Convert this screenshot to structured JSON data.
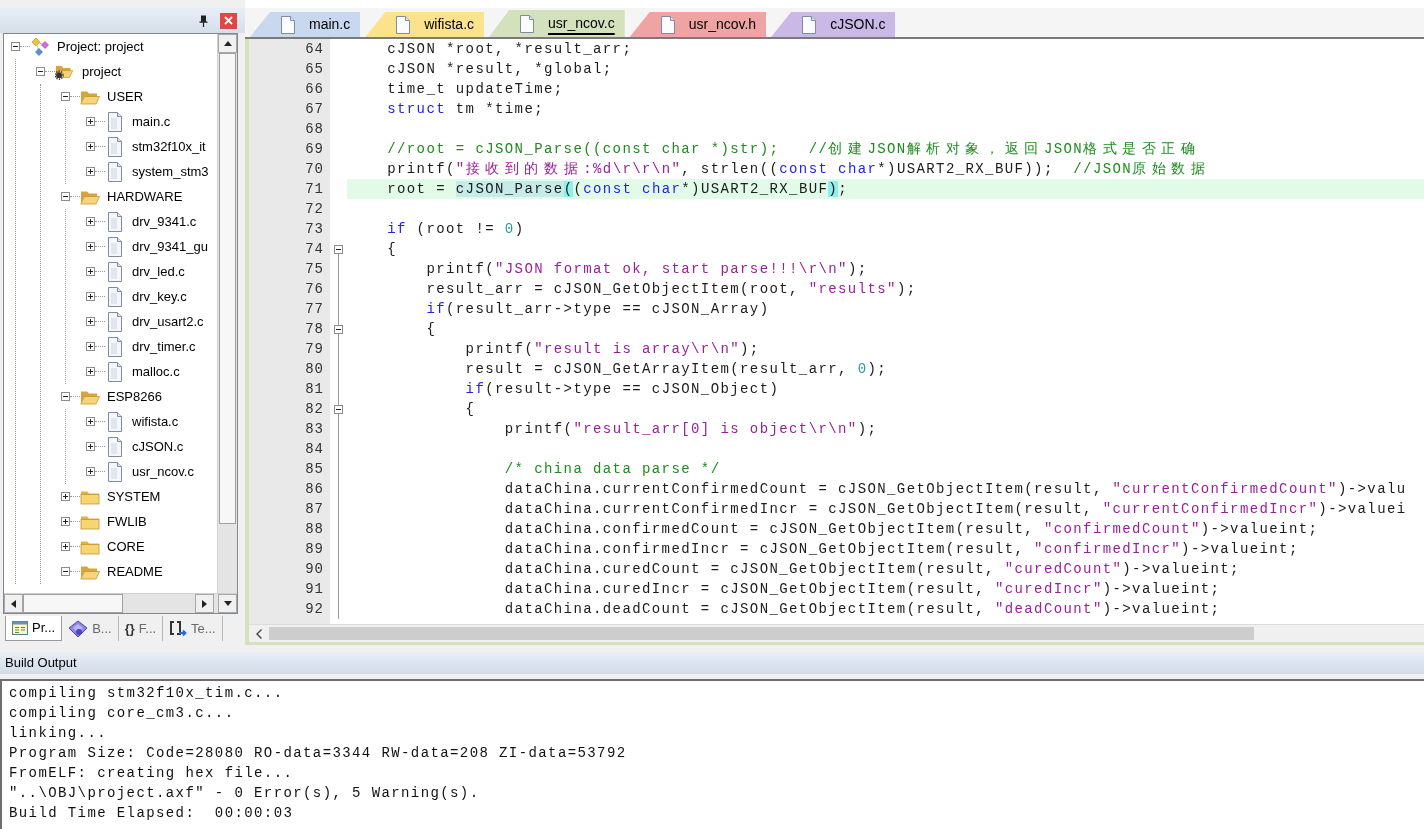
{
  "explorer": {
    "tree": [
      {
        "label": "Project: project",
        "kind": "project",
        "expanded": true,
        "children": [
          {
            "label": "project",
            "kind": "target",
            "expanded": true,
            "children": [
              {
                "label": "USER",
                "kind": "group",
                "expanded": true,
                "children": [
                  {
                    "label": "main.c",
                    "kind": "file",
                    "expanded": false
                  },
                  {
                    "label": "stm32f10x_it",
                    "kind": "file",
                    "expanded": false
                  },
                  {
                    "label": "system_stm3",
                    "kind": "file",
                    "expanded": false
                  }
                ]
              },
              {
                "label": "HARDWARE",
                "kind": "group",
                "expanded": true,
                "children": [
                  {
                    "label": "drv_9341.c",
                    "kind": "file",
                    "expanded": false
                  },
                  {
                    "label": "drv_9341_gu",
                    "kind": "file",
                    "expanded": false
                  },
                  {
                    "label": "drv_led.c",
                    "kind": "file",
                    "expanded": false
                  },
                  {
                    "label": "drv_key.c",
                    "kind": "file",
                    "expanded": false
                  },
                  {
                    "label": "drv_usart2.c",
                    "kind": "file",
                    "expanded": false
                  },
                  {
                    "label": "drv_timer.c",
                    "kind": "file",
                    "expanded": false
                  },
                  {
                    "label": "malloc.c",
                    "kind": "file",
                    "expanded": false
                  }
                ]
              },
              {
                "label": "ESP8266",
                "kind": "group",
                "expanded": true,
                "children": [
                  {
                    "label": "wifista.c",
                    "kind": "file",
                    "expanded": false
                  },
                  {
                    "label": "cJSON.c",
                    "kind": "file",
                    "expanded": false
                  },
                  {
                    "label": "usr_ncov.c",
                    "kind": "file",
                    "expanded": false
                  }
                ]
              },
              {
                "label": "SYSTEM",
                "kind": "group",
                "expanded": false
              },
              {
                "label": "FWLIB",
                "kind": "group",
                "expanded": false
              },
              {
                "label": "CORE",
                "kind": "group",
                "expanded": false
              },
              {
                "label": "README",
                "kind": "group",
                "expanded": true
              }
            ]
          }
        ]
      }
    ],
    "tabs": [
      {
        "label": "Pr...",
        "kind": "project",
        "selected": true
      },
      {
        "label": "B...",
        "kind": "books",
        "selected": false
      },
      {
        "label": "F...",
        "kind": "functions",
        "glyph": "{}",
        "selected": false
      },
      {
        "label": "Te...",
        "kind": "templates",
        "selected": false
      }
    ]
  },
  "editor": {
    "tabs": [
      {
        "label": "main.c",
        "color": "#c7d8ef",
        "selected": false
      },
      {
        "label": "wifista.c",
        "color": "#fbe38d",
        "selected": false
      },
      {
        "label": "usr_ncov.c",
        "color": "#d3e1bc",
        "selected": true
      },
      {
        "label": "usr_ncov.h",
        "color": "#f0a3a3",
        "selected": false
      },
      {
        "label": "cJSON.c",
        "color": "#cab9e6",
        "selected": false
      }
    ],
    "lines": [
      {
        "number": "64",
        "fold": false,
        "current": false,
        "segments": [
          {
            "kind": "plain",
            "text": "    cJSON *root, *result_arr;"
          }
        ]
      },
      {
        "number": "65",
        "fold": false,
        "current": false,
        "segments": [
          {
            "kind": "plain",
            "text": "    cJSON *result, *global;"
          }
        ]
      },
      {
        "number": "66",
        "fold": false,
        "current": false,
        "segments": [
          {
            "kind": "plain",
            "text": "    time_t updateTime;"
          }
        ]
      },
      {
        "number": "67",
        "fold": false,
        "current": false,
        "segments": [
          {
            "kind": "keyword",
            "text": "    struct"
          },
          {
            "kind": "plain",
            "text": " tm *time;"
          }
        ]
      },
      {
        "number": "68",
        "fold": false,
        "current": false
      },
      {
        "number": "69",
        "fold": false,
        "current": false,
        "segments": [
          {
            "kind": "comment",
            "text": "    //root = cJSON_Parse((const char *)str);   //创建JSON解析对象，返回JSON格式是否正确"
          }
        ]
      },
      {
        "number": "70",
        "fold": false,
        "current": false,
        "segments": [
          {
            "kind": "plain",
            "text": "    printf("
          },
          {
            "kind": "string",
            "text": "\"接收到的数据:%d\\r\\r\\n\""
          },
          {
            "kind": "plain",
            "text": ", strlen(("
          },
          {
            "kind": "keyword",
            "text": "const char"
          },
          {
            "kind": "plain",
            "text": "*)USART2_RX_BUF));  "
          },
          {
            "kind": "comment",
            "text": "//JSON原始数据"
          }
        ]
      },
      {
        "number": "71",
        "fold": false,
        "current": true,
        "segments": [
          {
            "kind": "plain",
            "text": "    root = "
          },
          {
            "kind": "highlight",
            "text": "cJSON_Parse"
          },
          {
            "kind": "brace",
            "text": "("
          },
          {
            "kind": "plain",
            "text": "("
          },
          {
            "kind": "keyword",
            "text": "const char"
          },
          {
            "kind": "plain",
            "text": "*)USART2_RX_BUF"
          },
          {
            "kind": "brace",
            "text": ")"
          },
          {
            "kind": "plain",
            "text": ";"
          }
        ]
      },
      {
        "number": "72",
        "fold": false,
        "current": false
      },
      {
        "number": "73",
        "fold": false,
        "current": false,
        "segments": [
          {
            "kind": "keyword",
            "text": "    if"
          },
          {
            "kind": "plain",
            "text": " (root != "
          },
          {
            "kind": "number",
            "text": "0"
          },
          {
            "kind": "plain",
            "text": ")"
          }
        ]
      },
      {
        "number": "74",
        "fold": true,
        "current": false,
        "segments": [
          {
            "kind": "plain",
            "text": "    {"
          }
        ]
      },
      {
        "number": "75",
        "fold": false,
        "current": false,
        "segments": [
          {
            "kind": "plain",
            "text": "        printf("
          },
          {
            "kind": "string",
            "text": "\"JSON format ok, start parse!!!\\r\\n\""
          },
          {
            "kind": "plain",
            "text": ");"
          }
        ]
      },
      {
        "number": "76",
        "fold": false,
        "current": false,
        "segments": [
          {
            "kind": "plain",
            "text": "        result_arr = cJSON_GetObjectItem(root, "
          },
          {
            "kind": "string",
            "text": "\"results\""
          },
          {
            "kind": "plain",
            "text": ");"
          }
        ]
      },
      {
        "number": "77",
        "fold": false,
        "current": false,
        "segments": [
          {
            "kind": "keyword",
            "text": "        if"
          },
          {
            "kind": "plain",
            "text": "(result_arr->type == cJSON_Array)"
          }
        ]
      },
      {
        "number": "78",
        "fold": true,
        "current": false,
        "segments": [
          {
            "kind": "plain",
            "text": "        {"
          }
        ]
      },
      {
        "number": "79",
        "fold": false,
        "current": false,
        "segments": [
          {
            "kind": "plain",
            "text": "            printf("
          },
          {
            "kind": "string",
            "text": "\"result is array\\r\\n\""
          },
          {
            "kind": "plain",
            "text": ");"
          }
        ]
      },
      {
        "number": "80",
        "fold": false,
        "current": false,
        "segments": [
          {
            "kind": "plain",
            "text": "            result = cJSON_GetArrayItem(result_arr, "
          },
          {
            "kind": "number",
            "text": "0"
          },
          {
            "kind": "plain",
            "text": ");"
          }
        ]
      },
      {
        "number": "81",
        "fold": false,
        "current": false,
        "segments": [
          {
            "kind": "keyword",
            "text": "            if"
          },
          {
            "kind": "plain",
            "text": "(result->type == cJSON_Object)"
          }
        ]
      },
      {
        "number": "82",
        "fold": true,
        "current": false,
        "segments": [
          {
            "kind": "plain",
            "text": "            {"
          }
        ]
      },
      {
        "number": "83",
        "fold": false,
        "current": false,
        "segments": [
          {
            "kind": "plain",
            "text": "                printf("
          },
          {
            "kind": "string",
            "text": "\"result_arr[0] is object\\r\\n\""
          },
          {
            "kind": "plain",
            "text": ");"
          }
        ]
      },
      {
        "number": "84",
        "fold": false,
        "current": false
      },
      {
        "number": "85",
        "fold": false,
        "current": false,
        "segments": [
          {
            "kind": "comment",
            "text": "                /* china data parse */"
          }
        ]
      },
      {
        "number": "86",
        "fold": false,
        "current": false,
        "segments": [
          {
            "kind": "plain",
            "text": "                dataChina.currentConfirmedCount = cJSON_GetObjectItem(result, "
          },
          {
            "kind": "string",
            "text": "\"currentConfirmedCount\""
          },
          {
            "kind": "plain",
            "text": ")->valu"
          }
        ]
      },
      {
        "number": "87",
        "fold": false,
        "current": false,
        "segments": [
          {
            "kind": "plain",
            "text": "                dataChina.currentConfirmedIncr = cJSON_GetObjectItem(result, "
          },
          {
            "kind": "string",
            "text": "\"currentConfirmedIncr\""
          },
          {
            "kind": "plain",
            "text": ")->valuei"
          }
        ]
      },
      {
        "number": "88",
        "fold": false,
        "current": false,
        "segments": [
          {
            "kind": "plain",
            "text": "                dataChina.confirmedCount = cJSON_GetObjectItem(result, "
          },
          {
            "kind": "string",
            "text": "\"confirmedCount\""
          },
          {
            "kind": "plain",
            "text": ")->valueint;"
          }
        ]
      },
      {
        "number": "89",
        "fold": false,
        "current": false,
        "segments": [
          {
            "kind": "plain",
            "text": "                dataChina.confirmedIncr = cJSON_GetObjectItem(result, "
          },
          {
            "kind": "string",
            "text": "\"confirmedIncr\""
          },
          {
            "kind": "plain",
            "text": ")->valueint;"
          }
        ]
      },
      {
        "number": "90",
        "fold": false,
        "current": false,
        "segments": [
          {
            "kind": "plain",
            "text": "                dataChina.curedCount = cJSON_GetObjectItem(result, "
          },
          {
            "kind": "string",
            "text": "\"curedCount\""
          },
          {
            "kind": "plain",
            "text": ")->valueint;"
          }
        ]
      },
      {
        "number": "91",
        "fold": false,
        "current": false,
        "segments": [
          {
            "kind": "plain",
            "text": "                dataChina.curedIncr = cJSON_GetObjectItem(result, "
          },
          {
            "kind": "string",
            "text": "\"curedIncr\""
          },
          {
            "kind": "plain",
            "text": ")->valueint;"
          }
        ]
      },
      {
        "number": "92",
        "fold": false,
        "current": false,
        "segments": [
          {
            "kind": "plain",
            "text": "                dataChina.deadCount = cJSON_GetObjectItem(result, "
          },
          {
            "kind": "string",
            "text": "\"deadCount\""
          },
          {
            "kind": "plain",
            "text": ")->valueint;"
          }
        ]
      }
    ]
  },
  "build_output": {
    "title": "Build Output",
    "lines": [
      "compiling stm32f10x_tim.c...",
      "compiling core_cm3.c...",
      "linking...",
      "Program Size: Code=28080 RO-data=3344 RW-data=208 ZI-data=53792",
      "FromELF: creating hex file...",
      "\"..\\OBJ\\project.axf\" - 0 Error(s), 5 Warning(s).",
      "Build Time Elapsed:  00:00:03"
    ]
  }
}
